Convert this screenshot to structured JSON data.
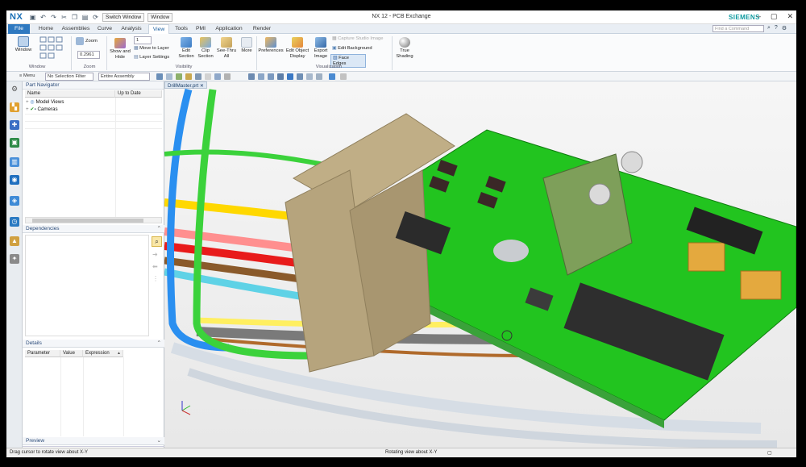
{
  "app": {
    "logo": "NX",
    "window_title": "NX 12 - PCB Exchange",
    "brand": "SIEMENS",
    "switch_window": "Switch Window",
    "window_menu": "Window"
  },
  "tabs": [
    {
      "label": "File"
    },
    {
      "label": "Home"
    },
    {
      "label": "Assemblies"
    },
    {
      "label": "Curve"
    },
    {
      "label": "Analysis"
    },
    {
      "label": "View",
      "active": true
    },
    {
      "label": "Tools"
    },
    {
      "label": "PMI"
    },
    {
      "label": "Application"
    },
    {
      "label": "Render"
    }
  ],
  "search": {
    "placeholder": "Find a Command"
  },
  "ribbon": {
    "window_btn": "Window",
    "window_group": "Window",
    "zoom_btn": "Zoom",
    "zoom_value": "0.2961",
    "zoom_group": "Zoom",
    "layer_num": "1",
    "show_hide": "Show and Hide",
    "move_layer": "Move to Layer",
    "layer_settings": "Layer Settings",
    "edit_section": "Edit Section",
    "clip_section": "Clip Section",
    "see_thru": "See-Thru All",
    "more1": "More",
    "visibility_group": "Visibility",
    "preferences": "Preferences",
    "edit_object_display": "Edit Object Display",
    "export_image": "Export Image",
    "capture_studio": "Capture Studio Image",
    "edit_background": "Edit Background",
    "face_edges": "Face Edges",
    "visualization_group": "Visualization",
    "true_shading": "True Shading"
  },
  "toolbar2": {
    "menu": "Menu",
    "selection_filter": "No Selection Filter",
    "assembly": "Entire Assembly"
  },
  "part_navigator": {
    "title": "Part Navigator",
    "col_name": "Name",
    "col_uptodate": "Up to Date",
    "items": [
      "Model Views",
      "Cameras"
    ]
  },
  "dependencies": {
    "title": "Dependencies"
  },
  "details": {
    "title": "Details",
    "col_parameter": "Parameter",
    "col_value": "Value",
    "col_expression": "Expression"
  },
  "preview": {
    "title": "Preview"
  },
  "viewport": {
    "tab": "DrillMaster.prt"
  },
  "status": {
    "left": "Drag cursor to rotate view about X-Y",
    "center": "Rotating view about X-Y"
  },
  "colors": {
    "pcb": "#22c41f",
    "file_tab": "#2f79c0",
    "brand": "#0e9aa0"
  }
}
